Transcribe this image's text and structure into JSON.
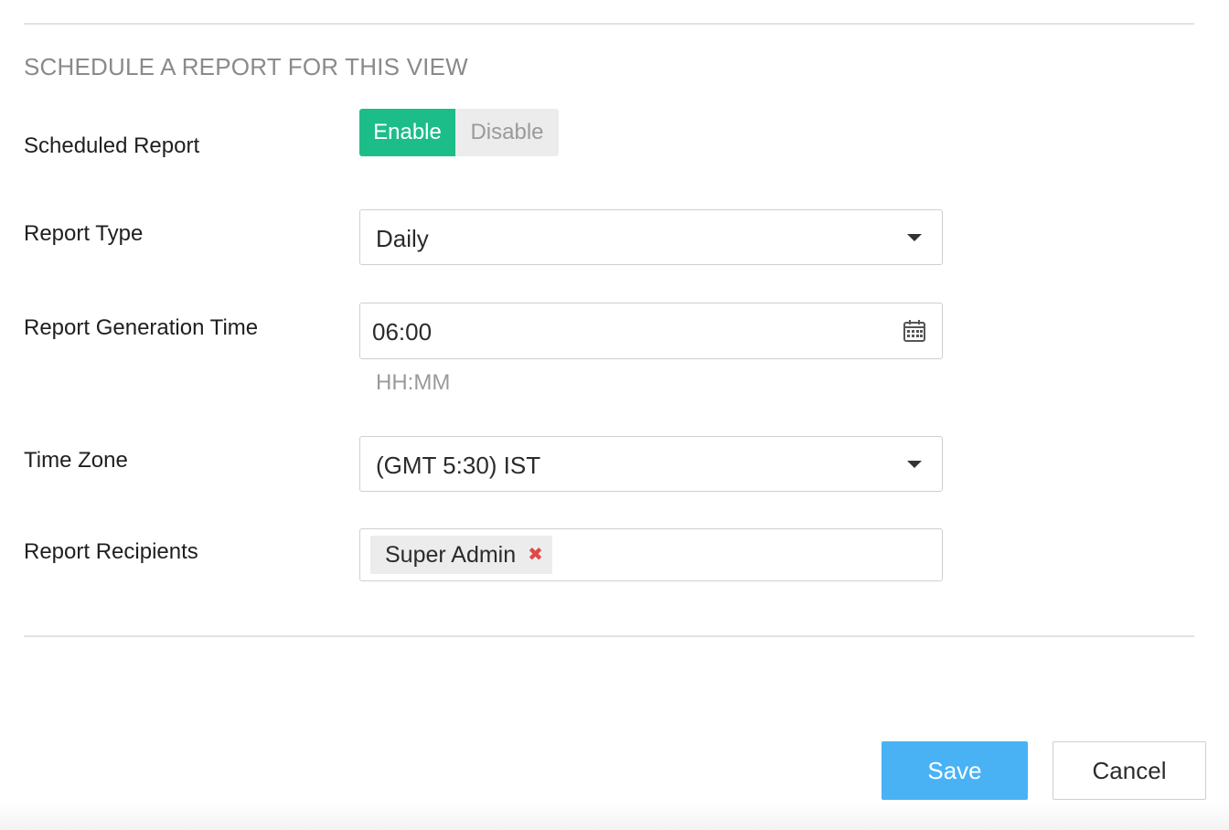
{
  "section": {
    "title": "SCHEDULE A REPORT FOR THIS VIEW"
  },
  "scheduled_report": {
    "label": "Scheduled Report",
    "options": [
      "Enable",
      "Disable"
    ],
    "selected": "Enable"
  },
  "report_type": {
    "label": "Report Type",
    "value": "Daily"
  },
  "generation_time": {
    "label": "Report Generation Time",
    "value": "06:00",
    "hint": "HH:MM"
  },
  "time_zone": {
    "label": "Time Zone",
    "value": "(GMT 5:30) IST"
  },
  "recipients": {
    "label": "Report Recipients",
    "chips": [
      {
        "label": "Super Admin",
        "remove_glyph": "✖"
      }
    ]
  },
  "actions": {
    "save_label": "Save",
    "cancel_label": "Cancel"
  },
  "colors": {
    "enable_active": "#1dbd8a",
    "save_button": "#48b2f5",
    "remove_x": "#e04848"
  },
  "icons": {
    "time_picker": "calendar-icon",
    "dropdown": "chevron-down-icon",
    "remove_chip": "close-icon"
  }
}
